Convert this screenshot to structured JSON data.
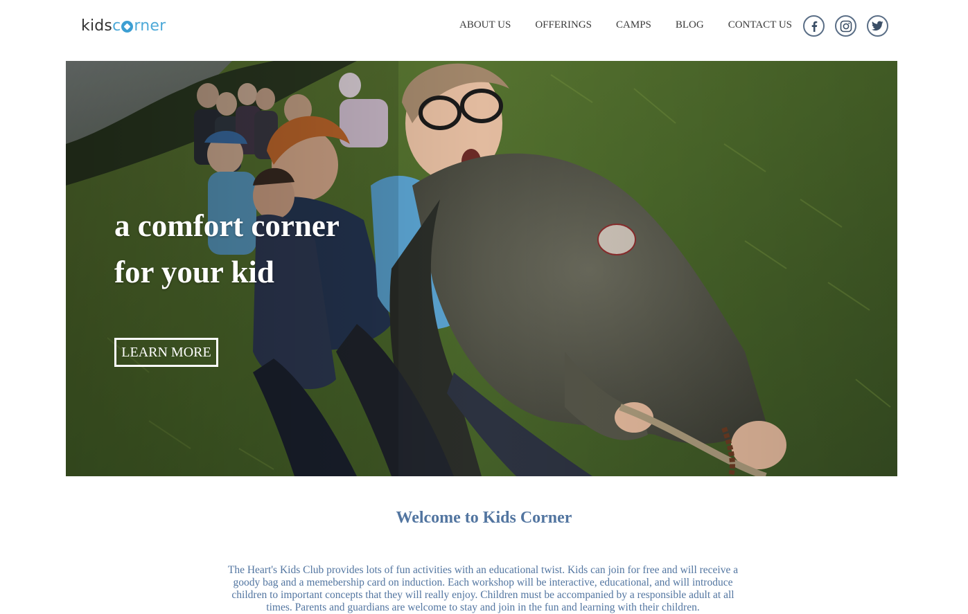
{
  "logo": {
    "part1": "kids",
    "part2": "rner"
  },
  "nav": {
    "items": [
      {
        "label": "ABOUT US"
      },
      {
        "label": "OFFERINGS"
      },
      {
        "label": "CAMPS"
      },
      {
        "label": "BLOG"
      },
      {
        "label": "CONTACT US"
      }
    ]
  },
  "social": {
    "icons": [
      "facebook-icon",
      "instagram-icon",
      "twitter-icon"
    ],
    "color": "#5a6e86"
  },
  "hero": {
    "title_line1": "a comfort corner",
    "title_line2": "for your kid",
    "button_label": "LEARN MORE"
  },
  "welcome": {
    "heading": "Welcome to Kids Corner",
    "body": "The Heart's Kids Club provides lots of fun activities with an educational twist. Kids can join for free and will receive a goody bag and a memebership card on induction. Each workshop will be interactive, educational, and will introduce children to important concepts that they will really enjoy. Children must be accompanied by a responsible adult at all times. Parents and guardians are welcome to stay and join in the fun and learning with their children."
  },
  "colors": {
    "accent": "#5275a0",
    "logo_blue": "#4da9d8",
    "nav_text": "#3a3a3a"
  }
}
